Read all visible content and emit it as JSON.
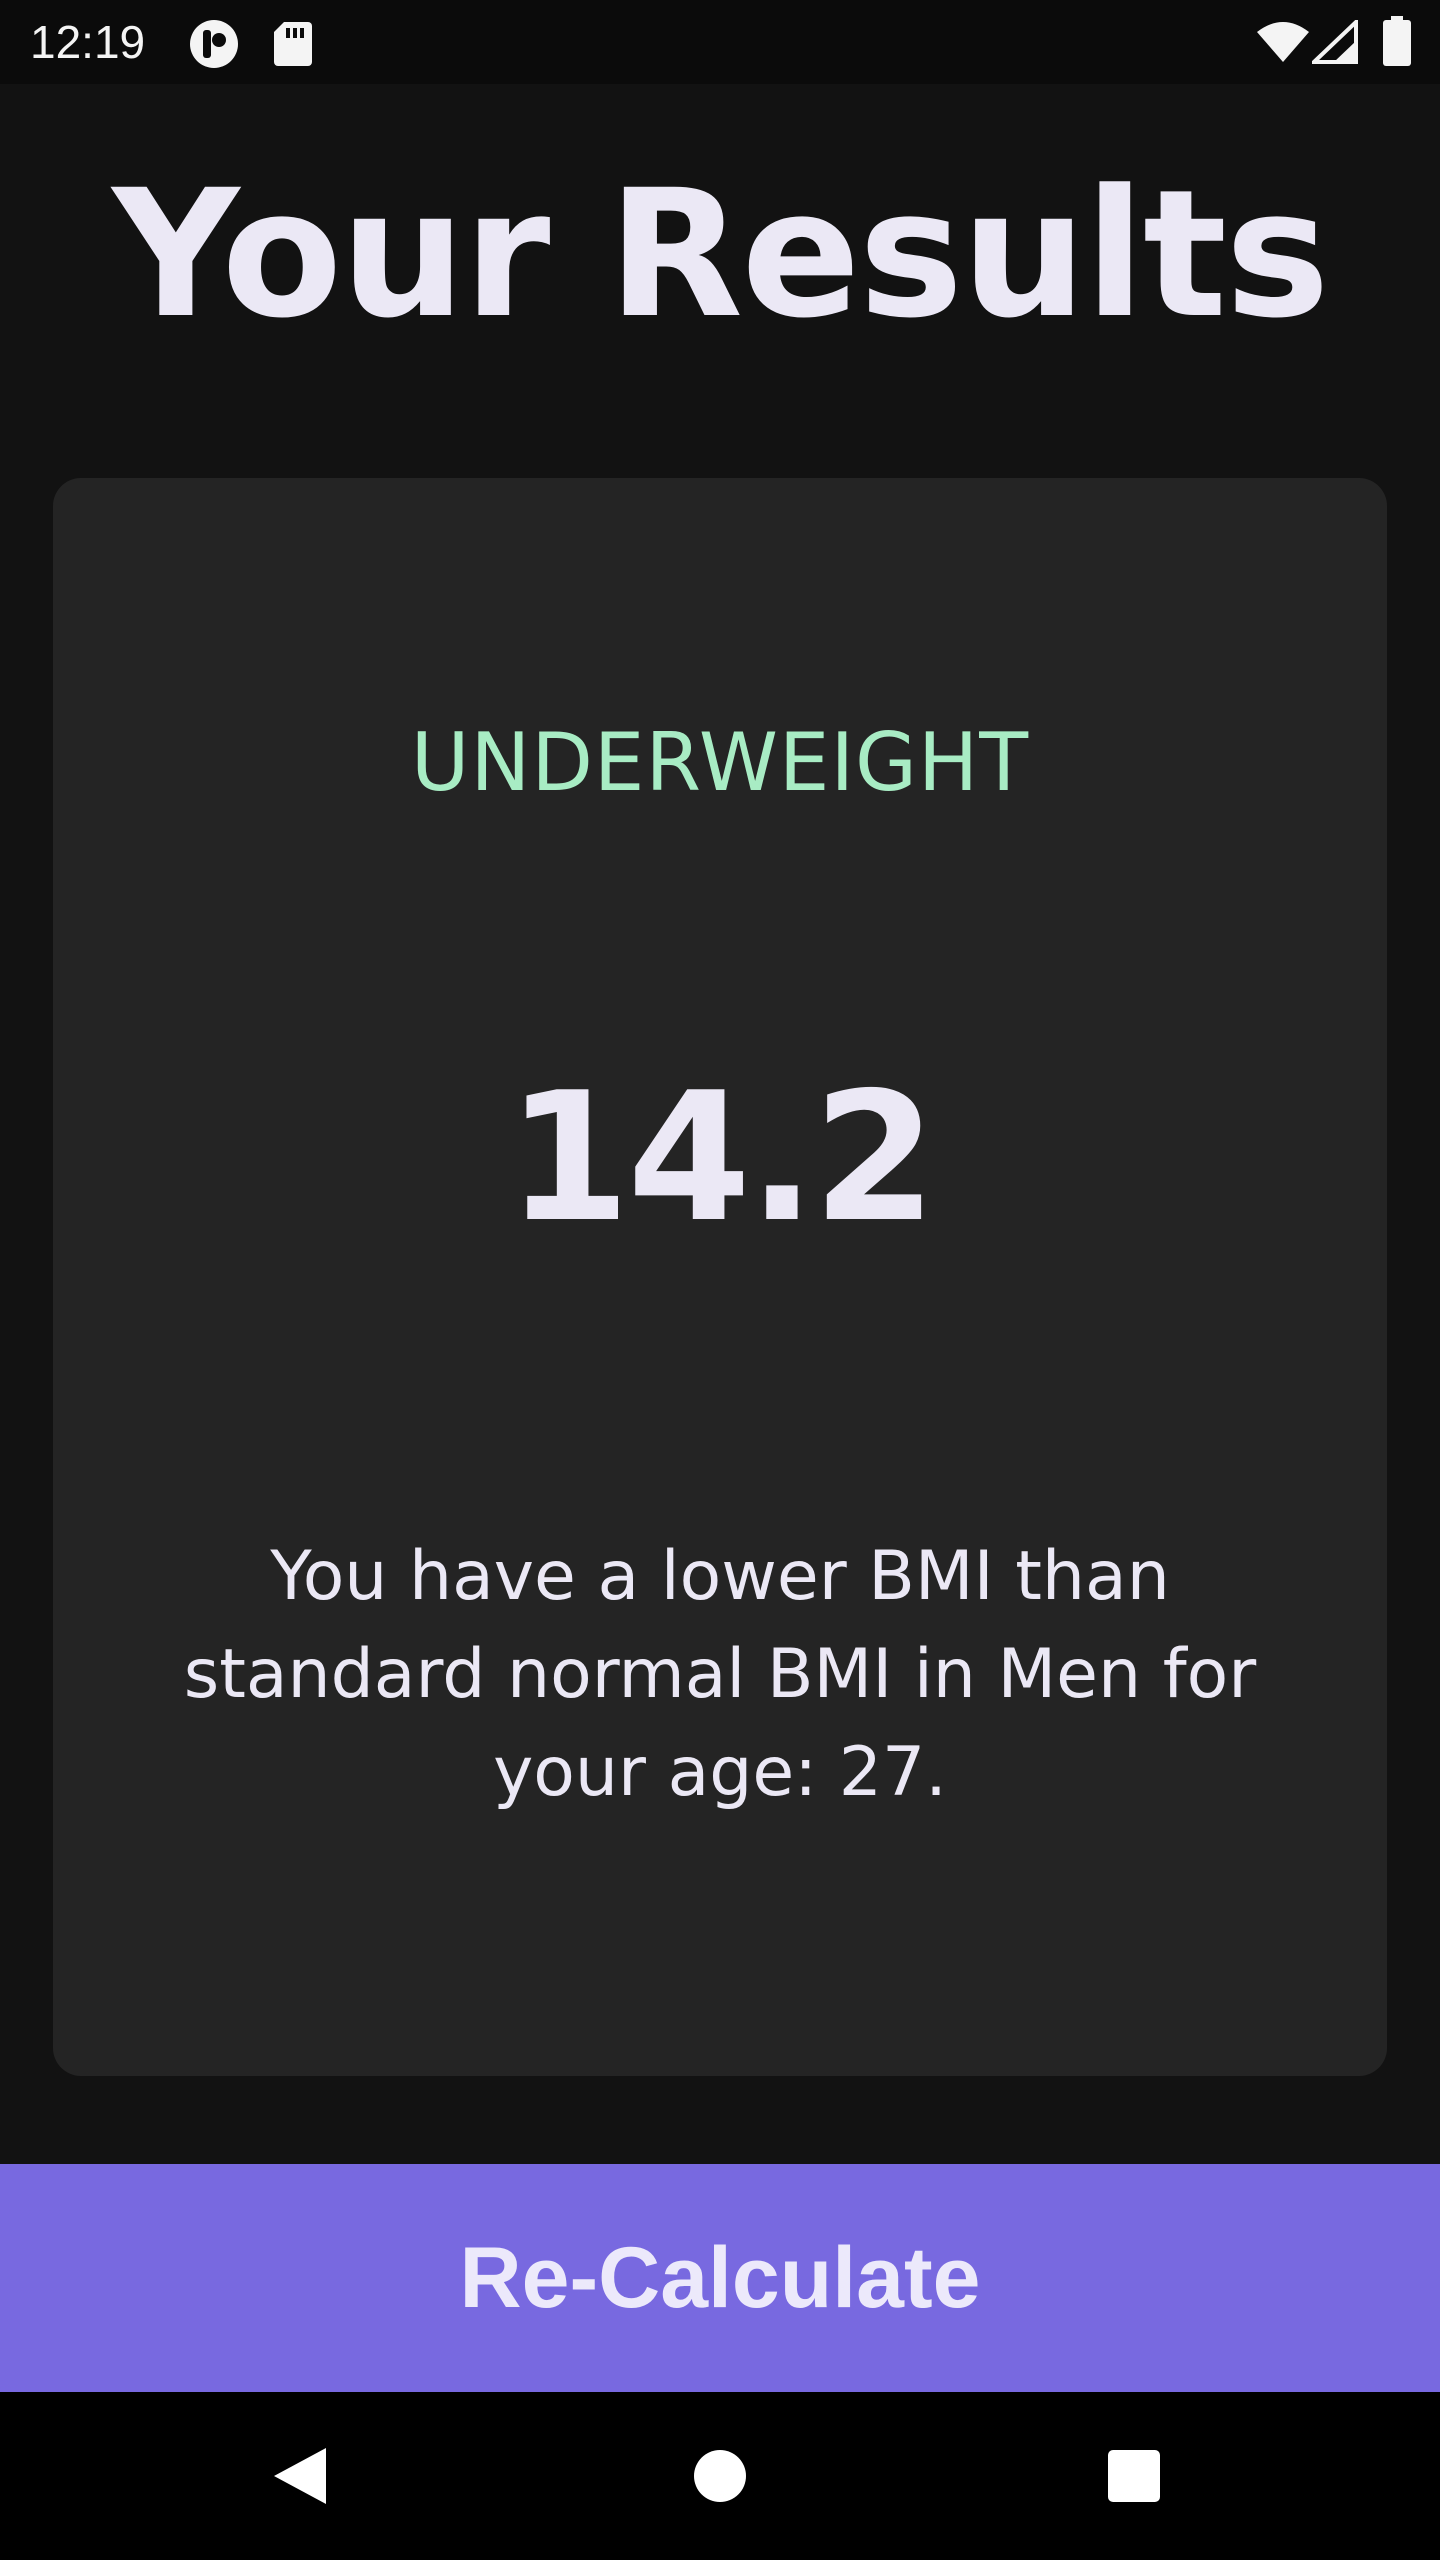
{
  "status_bar": {
    "time": "12:19",
    "icons": [
      "notification-icon",
      "sd-card-icon",
      "wifi-icon",
      "signal-icon",
      "battery-icon"
    ]
  },
  "page": {
    "title": "Your Results"
  },
  "result_card": {
    "category": "UNDERWEIGHT",
    "bmi_value": "14.2",
    "message": "You have a lower BMI than standard normal BMI in Men for your age: 27."
  },
  "actions": {
    "recalculate_label": "Re-Calculate"
  },
  "nav_bar": {
    "buttons": [
      "back-icon",
      "home-icon",
      "recents-icon"
    ]
  },
  "colors": {
    "background": "#121212",
    "card": "#242424",
    "accent": "#7869e0",
    "category_text": "#a8ecc4",
    "primary_text": "#ebe8f5"
  }
}
